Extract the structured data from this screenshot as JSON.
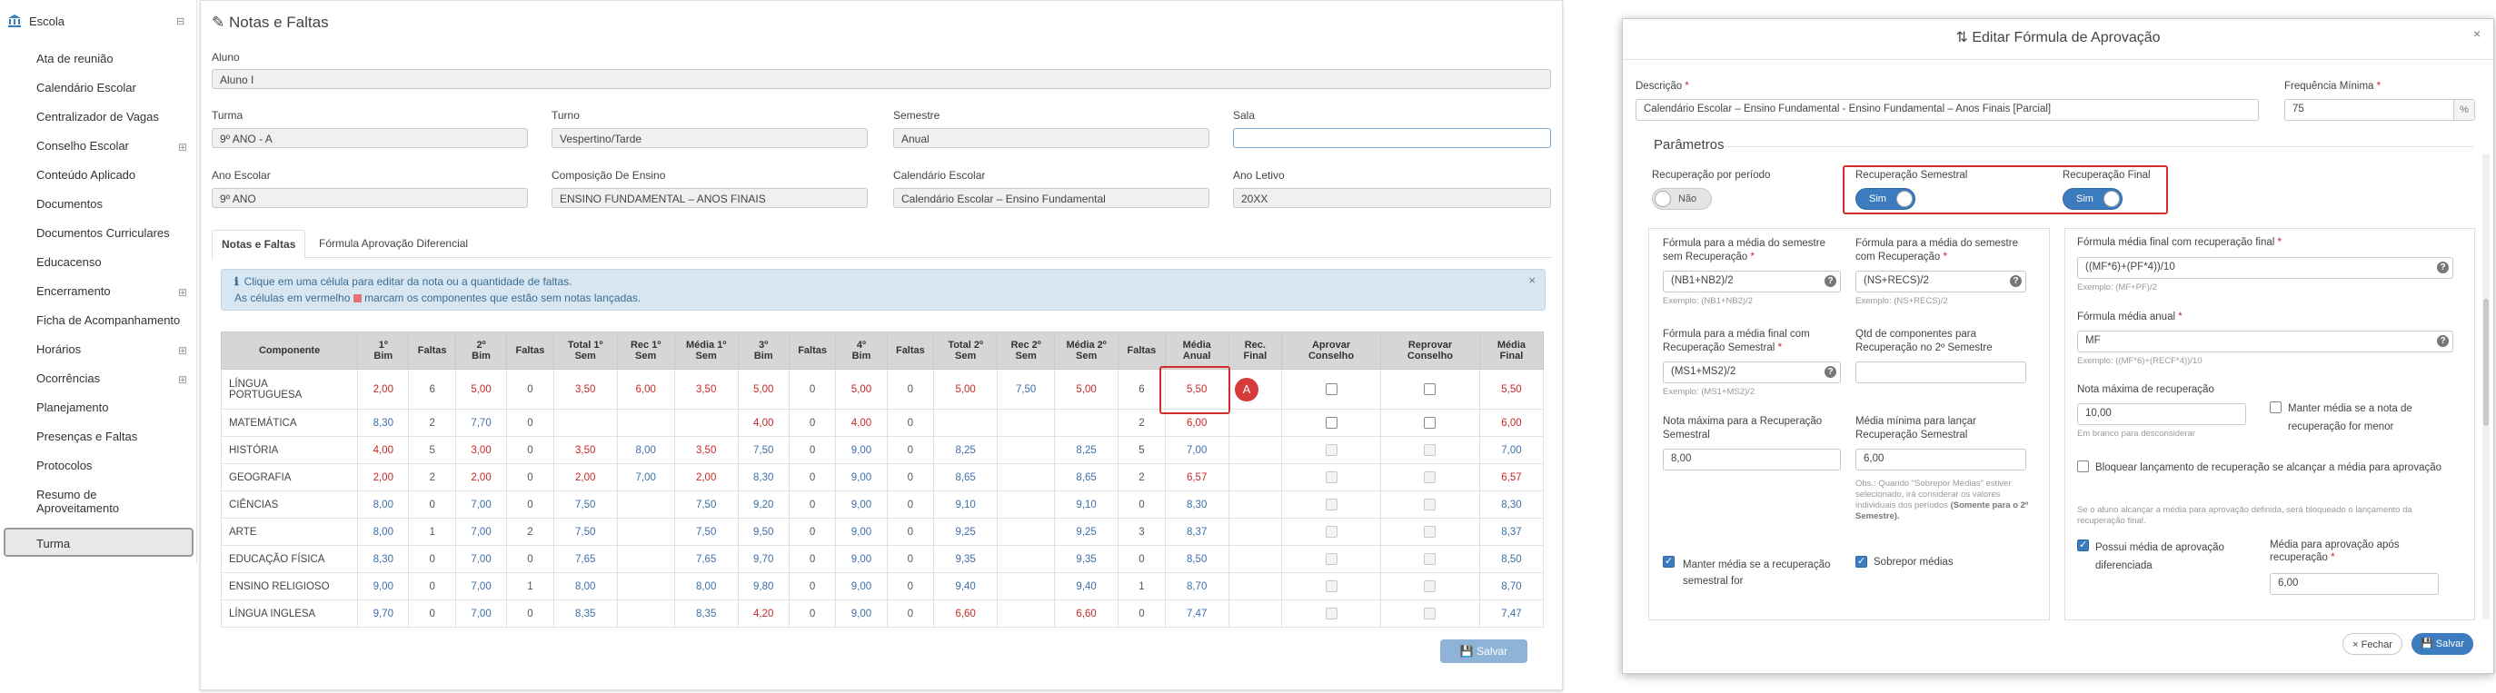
{
  "sidebar": {
    "section": "Escola",
    "items": [
      {
        "label": "Ata de reunião",
        "has_sub": false
      },
      {
        "label": "Calendário Escolar",
        "has_sub": false
      },
      {
        "label": "Centralizador de Vagas",
        "has_sub": false
      },
      {
        "label": "Conselho Escolar",
        "has_sub": true
      },
      {
        "label": "Conteúdo Aplicado",
        "has_sub": false
      },
      {
        "label": "Documentos",
        "has_sub": false
      },
      {
        "label": "Documentos Curriculares",
        "has_sub": false
      },
      {
        "label": "Educacenso",
        "has_sub": false
      },
      {
        "label": "Encerramento",
        "has_sub": true
      },
      {
        "label": "Ficha de Acompanhamento",
        "has_sub": false
      },
      {
        "label": "Horários",
        "has_sub": true
      },
      {
        "label": "Ocorrências",
        "has_sub": true
      },
      {
        "label": "Planejamento",
        "has_sub": false
      },
      {
        "label": "Presenças e Faltas",
        "has_sub": false
      },
      {
        "label": "Protocolos",
        "has_sub": false
      },
      {
        "label": "Resumo de",
        "label2": "Aproveitamento",
        "has_sub": false
      },
      {
        "label": "Turma",
        "has_sub": false,
        "active": true
      }
    ]
  },
  "main": {
    "title": "Notas e Faltas",
    "fields": {
      "aluno": {
        "label": "Aluno",
        "value": "Aluno I"
      },
      "turma": {
        "label": "Turma",
        "value": "9º ANO - A"
      },
      "turno": {
        "label": "Turno",
        "value": "Vespertino/Tarde"
      },
      "semestre": {
        "label": "Semestre",
        "value": "Anual"
      },
      "sala": {
        "label": "Sala",
        "value": ""
      },
      "ano_escolar": {
        "label": "Ano Escolar",
        "value": "9º ANO"
      },
      "composicao": {
        "label": "Composição De Ensino",
        "value": "ENSINO FUNDAMENTAL – ANOS FINAIS"
      },
      "calendario": {
        "label": "Calendário Escolar",
        "value": "Calendário Escolar – Ensino Fundamental"
      },
      "ano_letivo": {
        "label": "Ano Letivo",
        "value": "20XX"
      }
    },
    "tabs": [
      "Notas e Faltas",
      "Fórmula Aprovação Diferencial"
    ],
    "alert": {
      "line1": "Clique em uma célula para editar da nota ou a quantidade de faltas.",
      "line2a": "As células em vermelho",
      "line2b": "marcam os componentes que estão sem notas lançadas."
    },
    "table": {
      "headers": [
        [
          "Componente"
        ],
        [
          "1º",
          "Bim"
        ],
        [
          "Faltas"
        ],
        [
          "2º",
          "Bim"
        ],
        [
          "Faltas"
        ],
        [
          "Total 1º",
          "Sem"
        ],
        [
          "Rec 1º",
          "Sem"
        ],
        [
          "Média 1º",
          "Sem"
        ],
        [
          "3º",
          "Bim"
        ],
        [
          "Faltas"
        ],
        [
          "4º",
          "Bim"
        ],
        [
          "Faltas"
        ],
        [
          "Total 2º",
          "Sem"
        ],
        [
          "Rec 2º",
          "Sem"
        ],
        [
          "Média 2º",
          "Sem"
        ],
        [
          "Faltas"
        ],
        [
          "Média",
          "Anual"
        ],
        [
          "Rec.",
          "Final"
        ],
        [
          "Aprovar",
          "Conselho"
        ],
        [
          "Reprovar",
          "Conselho"
        ],
        [
          "Média",
          "Final"
        ]
      ],
      "rows": [
        {
          "name": "LÍNGUA",
          "name2": "PORTUGUESA",
          "cells": [
            "2,00",
            "6",
            "5,00",
            "0",
            "3,50",
            "6,00",
            "3,50",
            "5,00",
            "0",
            "5,00",
            "0",
            "5,00",
            "7,50",
            "5,00",
            "6",
            "5,50",
            "",
            "",
            "",
            "5,50"
          ]
        },
        {
          "name": "MATEMÁTICA",
          "cells": [
            "8,30",
            "2",
            "7,70",
            "0",
            "",
            "",
            "",
            "4,00",
            "0",
            "4,00",
            "0",
            "",
            "",
            "",
            "2",
            "6,00",
            "",
            "",
            "",
            "6,00"
          ]
        },
        {
          "name": "HISTÓRIA",
          "cells": [
            "4,00",
            "5",
            "3,00",
            "0",
            "3,50",
            "8,00",
            "3,50",
            "7,50",
            "0",
            "9,00",
            "0",
            "8,25",
            "",
            "8,25",
            "5",
            "7,00",
            "",
            "",
            "",
            "7,00"
          ]
        },
        {
          "name": "GEOGRAFIA",
          "cells": [
            "2,00",
            "2",
            "2,00",
            "0",
            "2,00",
            "7,00",
            "2,00",
            "8,30",
            "0",
            "9,00",
            "0",
            "8,65",
            "",
            "8,65",
            "2",
            "6,57",
            "",
            "",
            "",
            "6,57"
          ]
        },
        {
          "name": "CIÊNCIAS",
          "cells": [
            "8,00",
            "0",
            "7,00",
            "0",
            "7,50",
            "",
            "7,50",
            "9,20",
            "0",
            "9,00",
            "0",
            "9,10",
            "",
            "9,10",
            "0",
            "8,30",
            "",
            "",
            "",
            "8,30"
          ]
        },
        {
          "name": "ARTE",
          "cells": [
            "8,00",
            "1",
            "7,00",
            "2",
            "7,50",
            "",
            "7,50",
            "9,50",
            "0",
            "9,00",
            "0",
            "9,25",
            "",
            "9,25",
            "3",
            "8,37",
            "",
            "",
            "",
            "8,37"
          ]
        },
        {
          "name": "EDUCAÇÃO FÍSICA",
          "cells": [
            "8,30",
            "0",
            "7,00",
            "0",
            "7,65",
            "",
            "7,65",
            "9,70",
            "0",
            "9,00",
            "0",
            "9,35",
            "",
            "9,35",
            "0",
            "8,50",
            "",
            "",
            "",
            "8,50"
          ]
        },
        {
          "name": "ENSINO RELIGIOSO",
          "cells": [
            "9,00",
            "0",
            "7,00",
            "1",
            "8,00",
            "",
            "8,00",
            "9,80",
            "0",
            "9,00",
            "0",
            "9,40",
            "",
            "9,40",
            "1",
            "8,70",
            "",
            "",
            "",
            "8,70"
          ]
        },
        {
          "name": "LÍNGUA INGLESA",
          "cells": [
            "9,70",
            "0",
            "7,00",
            "0",
            "8,35",
            "",
            "8,35",
            "4,20",
            "0",
            "9,00",
            "0",
            "6,60",
            "",
            "6,60",
            "0",
            "7,47",
            "",
            "",
            "",
            "7,47"
          ]
        }
      ],
      "cell_colors": [
        [
          "red",
          "",
          "red",
          "",
          "red",
          "red",
          "red",
          "red",
          "",
          "red",
          "",
          "red",
          "blue",
          "red",
          "",
          "red",
          "",
          "",
          "",
          "red"
        ],
        [
          "blue",
          "",
          "blue",
          "",
          "",
          "",
          "",
          "red",
          "",
          "red",
          "",
          "",
          "",
          "",
          "",
          "red",
          "",
          "",
          "",
          "red"
        ],
        [
          "red",
          "",
          "red",
          "",
          "red",
          "blue",
          "red",
          "blue",
          "",
          "blue",
          "",
          "blue",
          "",
          "blue",
          "",
          "blue",
          "",
          "",
          "",
          "blue"
        ],
        [
          "red",
          "",
          "red",
          "",
          "red",
          "blue",
          "red",
          "blue",
          "",
          "blue",
          "",
          "blue",
          "",
          "blue",
          "",
          "red",
          "",
          "",
          "",
          "red"
        ],
        [
          "blue",
          "",
          "blue",
          "",
          "blue",
          "",
          "blue",
          "blue",
          "",
          "blue",
          "",
          "blue",
          "",
          "blue",
          "",
          "blue",
          "",
          "",
          "",
          "blue"
        ],
        [
          "blue",
          "",
          "blue",
          "",
          "blue",
          "",
          "blue",
          "blue",
          "",
          "blue",
          "",
          "blue",
          "",
          "blue",
          "",
          "blue",
          "",
          "",
          "",
          "blue"
        ],
        [
          "blue",
          "",
          "blue",
          "",
          "blue",
          "",
          "blue",
          "blue",
          "",
          "blue",
          "",
          "blue",
          "",
          "blue",
          "",
          "blue",
          "",
          "",
          "",
          "blue"
        ],
        [
          "blue",
          "",
          "blue",
          "",
          "blue",
          "",
          "blue",
          "blue",
          "",
          "blue",
          "",
          "blue",
          "",
          "blue",
          "",
          "blue",
          "",
          "",
          "",
          "blue"
        ],
        [
          "blue",
          "",
          "blue",
          "",
          "blue",
          "",
          "blue",
          "red",
          "",
          "blue",
          "",
          "red",
          "",
          "red",
          "",
          "blue",
          "",
          "",
          "",
          "blue"
        ]
      ]
    },
    "marker": "A",
    "save_label": "Salvar"
  },
  "modal": {
    "title": "Editar Fórmula de Aprovação",
    "descricao": {
      "label": "Descrição",
      "value": "Calendário Escolar – Ensino Fundamental - Ensino Fundamental – Anos Finais [Parcial]"
    },
    "frequencia": {
      "label": "Frequência Mínima",
      "value": "75",
      "addon": "%"
    },
    "parametros_title": "Parâmetros",
    "toggles": {
      "rec_periodo": {
        "label": "Recuperação por período",
        "state": "Não"
      },
      "rec_semestral": {
        "label": "Recuperação Semestral",
        "state": "Sim"
      },
      "rec_final": {
        "label": "Recuperação Final",
        "state": "Sim"
      }
    },
    "col1": {
      "f1_label": "Fórmula para a média do semestre sem Recuperação",
      "f1_value": "(NB1+NB2)/2",
      "f1_hint": "Exemplo: (NB1+NB2)/2",
      "f2_label": "Fórmula para a média final com Recuperação Semestral",
      "f2_value": "(MS1+MS2)/2",
      "f2_hint": "Exemplo: (MS1+MS2)/2",
      "f3_label": "Nota máxima para a Recuperação Semestral",
      "f3_value": "8,00",
      "cb_label": "Manter média se a recuperação semestral for"
    },
    "col2": {
      "f1_label": "Fórmula para a média do semestre com Recuperação",
      "f1_value": "(NS+RECS)/2",
      "f1_hint": "Exemplo: (NS+RECS)/2",
      "f2_label": "Qtd de componentes para Recuperação no 2º Semestre",
      "f2_value": "",
      "f3_label": "Média mínima para lançar Recuperação Semestral",
      "f3_value": "6,00",
      "obs": "Obs.: Quando \"Sobrepor Médias\" estiver selecionado, irá considerar os valores individuais dos períodos",
      "obs_bold": "(Somente para o 2º Semestre).",
      "cb_label": "Sobrepor médias"
    },
    "col3": {
      "f1_label": "Fórmula média final com recuperação final",
      "f1_value": "((MF*6)+(PF*4))/10",
      "f1_hint": "Exemplo: (MF+PF)/2",
      "f2_label": "Fórmula média anual",
      "f2_value": "MF",
      "f2_hint": "Exemplo: ((MF*6)+(RECF*4))/10",
      "f3_label": "Nota máxima de recuperação",
      "f3_value": "10,00",
      "f3_hint": "Em branco para desconsiderar",
      "cb1_label": "Manter média se a nota de recuperação for menor",
      "cb2_label": "Bloquear lançamento de recuperação se alcançar a média para aprovação",
      "cb2_hint": "Se o aluno alcançar a média para aprovação definida, será bloqueado o lançamento da recuperação final.",
      "cb3_label": "Possui média de aprovação diferenciada",
      "f4_label": "Média para aprovação após recuperação",
      "f4_value": "6,00"
    },
    "btn_fechar": "Fechar",
    "btn_salvar": "Salvar"
  }
}
